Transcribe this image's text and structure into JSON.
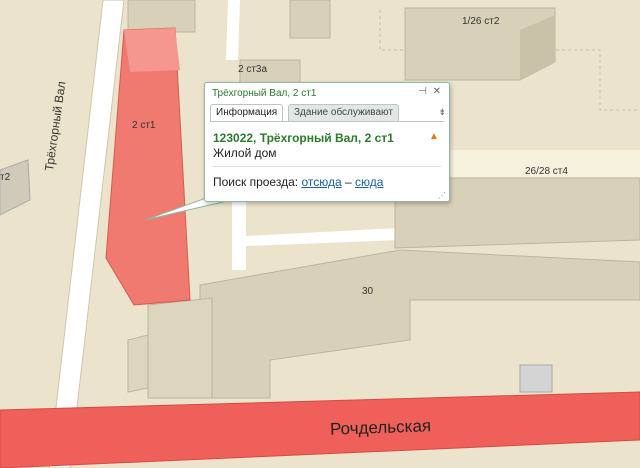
{
  "map": {
    "buildings": [
      {
        "id": "b1",
        "label": "1/26 ст2"
      },
      {
        "id": "b2",
        "label": "2 ст3а"
      },
      {
        "id": "b3",
        "label": "2 ст1"
      },
      {
        "id": "b4",
        "label": "26/28 ст4"
      },
      {
        "id": "b5",
        "label": "30"
      },
      {
        "id": "b6",
        "label": "т2"
      }
    ],
    "streets": {
      "vertical": "Трёхгорный Вал",
      "main": "Рочдельская"
    },
    "colors": {
      "background": "#ebe3cb",
      "road": "#ffffff",
      "main_road": "#f0605a",
      "highlight_building": "#f07a70",
      "building": "#d8d0b8"
    }
  },
  "popup": {
    "title": "Трёхгорный Вал, 2 ст1",
    "pin_icon": "pin-icon",
    "close_icon": "close-icon",
    "tabs": [
      {
        "label": "Информация",
        "active": true
      },
      {
        "label": "Здание обслуживают",
        "active": false
      }
    ],
    "address": "123022, Трёхгорный Вал, 2 ст1",
    "building_type": "Жилой дом",
    "route_label": "Поиск проезда:",
    "route_from": "отсюда",
    "route_dash": "–",
    "route_to": "сюда"
  }
}
